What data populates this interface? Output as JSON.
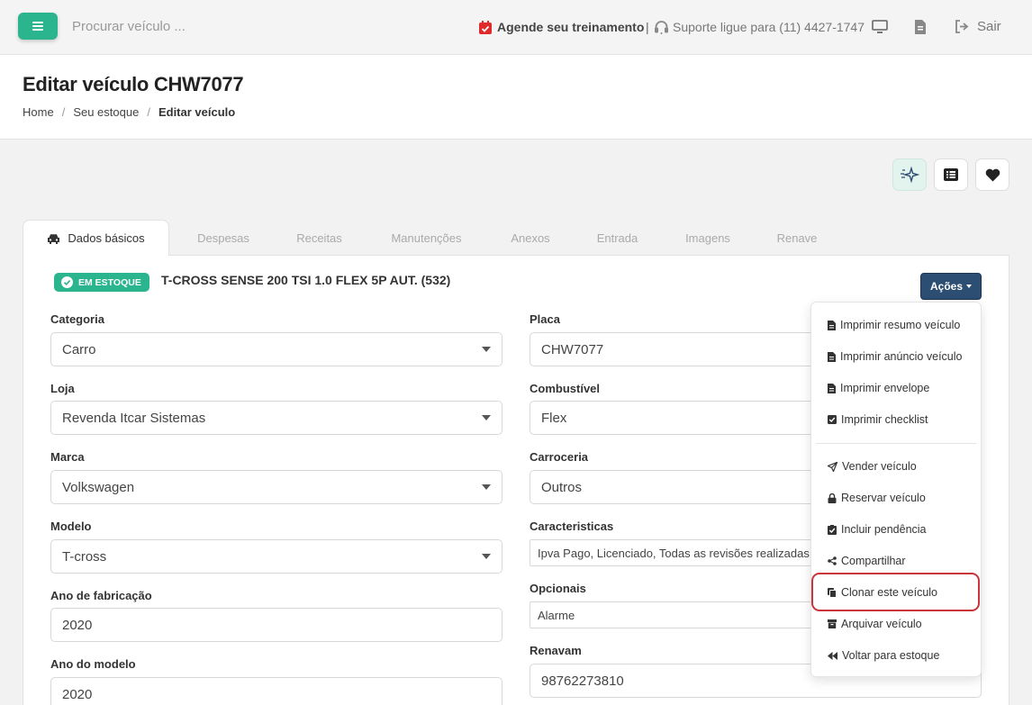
{
  "topbar": {
    "search_placeholder": "Procurar veículo ...",
    "schedule_label": "Agende seu treinamento",
    "separator": "|",
    "support_label": "Suporte ligue para (11) 4427-1747",
    "logout_label": "Sair"
  },
  "header": {
    "title": "Editar veículo CHW7077",
    "breadcrumb": [
      "Home",
      "Seu estoque",
      "Editar veículo"
    ],
    "breadcrumb_separator": "/"
  },
  "tabs": [
    {
      "label": "Dados básicos",
      "active": true
    },
    {
      "label": "Despesas"
    },
    {
      "label": "Receitas"
    },
    {
      "label": "Manutenções"
    },
    {
      "label": "Anexos"
    },
    {
      "label": "Entrada"
    },
    {
      "label": "Imagens"
    },
    {
      "label": "Renave"
    }
  ],
  "vehicle": {
    "status_badge": "EM ESTOQUE",
    "name": "T-CROSS SENSE 200 TSI 1.0 FLEX 5P AUT. (532)",
    "actions_label": "Ações"
  },
  "form": {
    "left": [
      {
        "label": "Categoria",
        "value": "Carro"
      },
      {
        "label": "Loja",
        "value": "Revenda Itcar Sistemas"
      },
      {
        "label": "Marca",
        "value": "Volkswagen"
      },
      {
        "label": "Modelo",
        "value": "T-cross"
      },
      {
        "label": "Ano de fabricação",
        "value": "2020"
      },
      {
        "label": "Ano do modelo",
        "value": "2020"
      }
    ],
    "right": [
      {
        "label": "Placa",
        "value": "CHW7077"
      },
      {
        "label": "Combustível",
        "value": "Flex"
      },
      {
        "label": "Carroceria",
        "value": "Outros"
      },
      {
        "label": "Caracteristicas",
        "value": "Ipva Pago, Licenciado, Todas as revisões realizadas"
      },
      {
        "label": "Opcionais",
        "value": "Alarme"
      },
      {
        "label": "Renavam",
        "value": "98762273810"
      }
    ]
  },
  "actions_menu": [
    {
      "label": "Imprimir resumo veículo",
      "icon": "file-icon"
    },
    {
      "label": "Imprimir anúncio veículo",
      "icon": "file-icon"
    },
    {
      "label": "Imprimir envelope",
      "icon": "file-icon"
    },
    {
      "label": "Imprimir checklist",
      "icon": "check-square-icon"
    },
    {
      "label": "Vender veículo",
      "icon": "send-icon"
    },
    {
      "label": "Reservar veículo",
      "icon": "lock-icon"
    },
    {
      "label": "Incluir pendência",
      "icon": "clipboard-check-icon"
    },
    {
      "label": "Compartilhar",
      "icon": "share-icon"
    },
    {
      "label": "Clonar este veículo",
      "icon": "copy-icon",
      "highlighted": true
    },
    {
      "label": "Arquivar veículo",
      "icon": "archive-icon"
    },
    {
      "label": "Voltar para estoque",
      "icon": "backward-icon"
    }
  ],
  "colors": {
    "accent_green": "#2bb58f",
    "actions_blue": "#2d4e73",
    "calendar_red": "#e02b2b",
    "highlight_red": "#c9353a"
  }
}
